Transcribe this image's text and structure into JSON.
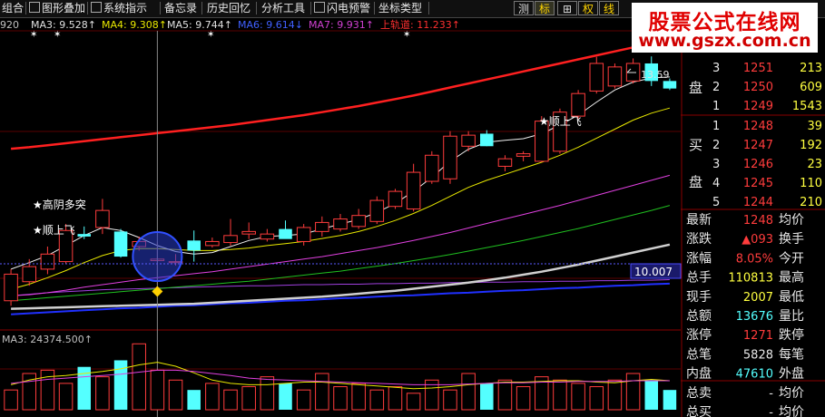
{
  "toolbar": {
    "items": [
      "组合",
      "图形叠加",
      "系统指示",
      "备忘录",
      "历史回忆",
      "分析工具",
      "闪电预警",
      "坐标类型"
    ],
    "right_buttons": [
      "测",
      "标",
      "⊞",
      "权",
      "线"
    ]
  },
  "watermark": {
    "name": "股票公式在线网",
    "url": "www.gszx.com.cn"
  },
  "ma_header": {
    "partial": "920",
    "items": [
      {
        "label": "MA3: 9.528↑",
        "color": "#e0e0e0"
      },
      {
        "label": "MA4: 9.308↑",
        "color": "#e8e800"
      },
      {
        "label": "MA5: 9.744↑",
        "color": "#e0e0e0"
      },
      {
        "label": "MA6: 9.614↓",
        "color": "#4060ff"
      },
      {
        "label": "MA7: 9.931↑",
        "color": "#d040d0"
      },
      {
        "label": "上轨道: 11.233↑",
        "color": "#ff3030"
      }
    ]
  },
  "annotations": {
    "high_yin": "★高阴多突",
    "shunshang_left": "★顺上飞",
    "shunshang_right": "★顺上飞",
    "max_label": "13.59",
    "price_box": "10.007"
  },
  "volume_header": {
    "ma3": "MA3: 24374.500↑"
  },
  "colors": {
    "up": "#ff3c3c",
    "down": "#54ffff",
    "upper_band": "#ff2020",
    "background": "#000000"
  },
  "chart_data": {
    "type": "candlestick",
    "price_range": [
      8.3,
      14.1
    ],
    "candles": [
      {
        "o": 8.72,
        "h": 9.35,
        "l": 8.62,
        "c": 9.25
      },
      {
        "o": 9.1,
        "h": 9.55,
        "l": 9.02,
        "c": 9.4
      },
      {
        "o": 9.35,
        "h": 9.8,
        "l": 9.25,
        "c": 9.65
      },
      {
        "o": 9.5,
        "h": 10.25,
        "l": 9.45,
        "c": 10.12
      },
      {
        "o": 10.05,
        "h": 10.2,
        "l": 9.95,
        "c": 10.0
      },
      {
        "o": 10.18,
        "h": 10.75,
        "l": 10.05,
        "c": 10.52
      },
      {
        "o": 10.1,
        "h": 10.15,
        "l": 9.58,
        "c": 9.6
      },
      {
        "o": 9.8,
        "h": 10.0,
        "l": 9.72,
        "c": 9.9
      },
      {
        "o": 9.52,
        "h": 9.9,
        "l": 9.05,
        "c": 9.55
      },
      {
        "o": 9.48,
        "h": 9.65,
        "l": 9.42,
        "c": 9.5
      },
      {
        "o": 9.92,
        "h": 10.12,
        "l": 9.5,
        "c": 9.72
      },
      {
        "o": 9.82,
        "h": 9.98,
        "l": 9.78,
        "c": 9.9
      },
      {
        "o": 9.88,
        "h": 10.35,
        "l": 9.82,
        "c": 10.02
      },
      {
        "o": 10.05,
        "h": 10.28,
        "l": 9.95,
        "c": 10.1
      },
      {
        "o": 9.95,
        "h": 10.15,
        "l": 9.9,
        "c": 10.05
      },
      {
        "o": 10.15,
        "h": 10.32,
        "l": 10.0,
        "c": 9.95
      },
      {
        "o": 9.9,
        "h": 10.25,
        "l": 9.82,
        "c": 10.18
      },
      {
        "o": 10.1,
        "h": 10.4,
        "l": 10.0,
        "c": 10.28
      },
      {
        "o": 10.15,
        "h": 10.45,
        "l": 10.1,
        "c": 10.35
      },
      {
        "o": 10.2,
        "h": 10.55,
        "l": 10.15,
        "c": 10.42
      },
      {
        "o": 10.3,
        "h": 10.8,
        "l": 10.25,
        "c": 10.72
      },
      {
        "o": 10.6,
        "h": 10.95,
        "l": 10.55,
        "c": 10.9
      },
      {
        "o": 10.55,
        "h": 11.45,
        "l": 10.5,
        "c": 11.28
      },
      {
        "o": 11.1,
        "h": 11.7,
        "l": 11.05,
        "c": 11.62
      },
      {
        "o": 11.15,
        "h": 12.1,
        "l": 11.05,
        "c": 12.0
      },
      {
        "o": 11.8,
        "h": 12.1,
        "l": 11.7,
        "c": 12.02
      },
      {
        "o": 12.05,
        "h": 12.12,
        "l": 11.8,
        "c": 11.8
      },
      {
        "o": 11.4,
        "h": 11.62,
        "l": 11.3,
        "c": 11.55
      },
      {
        "o": 11.6,
        "h": 11.7,
        "l": 11.5,
        "c": 11.65
      },
      {
        "o": 11.5,
        "h": 12.4,
        "l": 11.48,
        "c": 12.3
      },
      {
        "o": 11.7,
        "h": 12.55,
        "l": 11.65,
        "c": 12.48
      },
      {
        "o": 12.4,
        "h": 12.92,
        "l": 12.35,
        "c": 12.85
      },
      {
        "o": 12.9,
        "h": 13.58,
        "l": 12.85,
        "c": 13.45
      },
      {
        "o": 13.0,
        "h": 13.45,
        "l": 12.95,
        "c": 13.38
      },
      {
        "o": 13.1,
        "h": 13.55,
        "l": 13.05,
        "c": 13.45
      },
      {
        "o": 13.45,
        "h": 13.59,
        "l": 13.0,
        "c": 13.1
      },
      {
        "o": 13.1,
        "h": 13.15,
        "l": 12.92,
        "c": 12.95
      }
    ],
    "ma_short": [
      9.35,
      9.48,
      9.62,
      9.82,
      10.02,
      10.18,
      10.12,
      9.98,
      9.82,
      9.7,
      9.65,
      9.68,
      9.8,
      9.92,
      10.0,
      10.02,
      10.05,
      10.15,
      10.25,
      10.34,
      10.48,
      10.66,
      10.9,
      11.18,
      11.5,
      11.74,
      11.88,
      11.92,
      11.95,
      12.05,
      12.22,
      12.42,
      12.68,
      12.92,
      13.08,
      13.16,
      13.18
    ],
    "ma_yellow": [
      8.95,
      9.05,
      9.18,
      9.32,
      9.48,
      9.62,
      9.72,
      9.76,
      9.76,
      9.74,
      9.72,
      9.72,
      9.74,
      9.77,
      9.82,
      9.86,
      9.9,
      9.96,
      10.02,
      10.1,
      10.2,
      10.32,
      10.46,
      10.62,
      10.8,
      10.98,
      11.12,
      11.24,
      11.36,
      11.48,
      11.62,
      11.78,
      11.96,
      12.14,
      12.32,
      12.46,
      12.56
    ],
    "ma_magenta": [
      8.82,
      8.84,
      8.88,
      8.93,
      8.99,
      9.04,
      9.09,
      9.14,
      9.18,
      9.22,
      9.26,
      9.3,
      9.35,
      9.4,
      9.45,
      9.5,
      9.55,
      9.6,
      9.66,
      9.72,
      9.78,
      9.85,
      9.92,
      10.0,
      10.08,
      10.17,
      10.26,
      10.35,
      10.44,
      10.53,
      10.62,
      10.72,
      10.82,
      10.92,
      11.02,
      11.12,
      11.22
    ],
    "ma_green": [
      8.72,
      8.75,
      8.78,
      8.81,
      8.84,
      8.87,
      8.9,
      8.93,
      8.96,
      8.99,
      9.02,
      9.05,
      9.08,
      9.11,
      9.15,
      9.19,
      9.23,
      9.27,
      9.31,
      9.36,
      9.41,
      9.46,
      9.52,
      9.58,
      9.64,
      9.71,
      9.78,
      9.85,
      9.92,
      10.0,
      10.08,
      10.16,
      10.25,
      10.34,
      10.43,
      10.52,
      10.62
    ],
    "ma_white": [
      8.56,
      8.57,
      8.58,
      8.59,
      8.6,
      8.61,
      8.62,
      8.63,
      8.64,
      8.65,
      8.66,
      8.68,
      8.7,
      8.72,
      8.74,
      8.76,
      8.78,
      8.8,
      8.83,
      8.86,
      8.89,
      8.92,
      8.96,
      9.0,
      9.04,
      9.08,
      9.13,
      9.18,
      9.24,
      9.3,
      9.37,
      9.44,
      9.52,
      9.6,
      9.68,
      9.76,
      9.84
    ],
    "ma_purple_flat": [
      8.82,
      8.85,
      8.88,
      8.9,
      8.92,
      8.94,
      8.95,
      8.96,
      8.97,
      8.98,
      8.99,
      9.0,
      9.01,
      9.02,
      9.02,
      9.03,
      9.04,
      9.04,
      9.05,
      9.05,
      9.06,
      9.06,
      9.07,
      9.07,
      9.08,
      9.08,
      9.09,
      9.09,
      9.1,
      9.1,
      9.11,
      9.11,
      9.12,
      9.12,
      9.13,
      9.13,
      9.14
    ],
    "ma_blue": [
      8.45,
      8.47,
      8.49,
      8.51,
      8.53,
      8.55,
      8.57,
      8.58,
      8.6,
      8.62,
      8.63,
      8.65,
      8.67,
      8.68,
      8.7,
      8.72,
      8.73,
      8.75,
      8.77,
      8.78,
      8.8,
      8.82,
      8.83,
      8.85,
      8.87,
      8.88,
      8.9,
      8.92,
      8.93,
      8.95,
      8.97,
      8.98,
      9.0,
      9.02,
      9.03,
      9.05,
      9.06
    ],
    "upper_band": [
      11.75,
      11.78,
      11.82,
      11.86,
      11.9,
      11.94,
      11.98,
      12.02,
      12.06,
      12.1,
      12.14,
      12.18,
      12.22,
      12.27,
      12.32,
      12.37,
      12.42,
      12.48,
      12.54,
      12.6,
      12.67,
      12.74,
      12.81,
      12.89,
      12.97,
      13.05,
      13.13,
      13.21,
      13.29,
      13.37,
      13.45,
      13.53,
      13.61,
      13.69,
      13.77,
      13.85,
      13.93
    ],
    "volume": [
      30,
      55,
      60,
      40,
      65,
      50,
      75,
      100,
      60,
      45,
      30,
      40,
      30,
      35,
      50,
      40,
      30,
      55,
      35,
      40,
      30,
      35,
      25,
      45,
      30,
      55,
      40,
      45,
      35,
      50,
      45,
      40,
      35,
      45,
      55,
      45,
      30
    ],
    "volume_ma_a": [
      38,
      45,
      50,
      52,
      55,
      58,
      62,
      68,
      72,
      66,
      56,
      45,
      40,
      38,
      38,
      40,
      42,
      42,
      40,
      38,
      36,
      34,
      32,
      33,
      35,
      38,
      40,
      42,
      42,
      43,
      44,
      44,
      42,
      41,
      44,
      46,
      44
    ],
    "volume_ma_b": [
      40,
      43,
      46,
      48,
      50,
      52,
      54,
      57,
      60,
      60,
      58,
      55,
      52,
      48,
      46,
      45,
      44,
      43,
      42,
      41,
      40,
      39,
      38,
      38,
      38,
      39,
      40,
      41,
      41,
      42,
      42,
      43,
      43,
      43,
      44,
      44,
      44
    ]
  },
  "side_panel": {
    "sell_label_top": "盘",
    "sell_rows": [
      {
        "lvl": "3",
        "price": "1251",
        "vol": "213"
      },
      {
        "lvl": "2",
        "price": "1250",
        "vol": "609"
      },
      {
        "lvl": "1",
        "price": "1249",
        "vol": "1543"
      }
    ],
    "buy_label": "买",
    "buy_label2": "盘",
    "buy_rows": [
      {
        "lvl": "1",
        "price": "1248",
        "vol": "39"
      },
      {
        "lvl": "2",
        "price": "1247",
        "vol": "192"
      },
      {
        "lvl": "3",
        "price": "1246",
        "vol": "23"
      },
      {
        "lvl": "4",
        "price": "1245",
        "vol": "110"
      },
      {
        "lvl": "5",
        "price": "1244",
        "vol": "210"
      }
    ],
    "stats": [
      {
        "l1": "最新",
        "v1": "1248",
        "l2": "均价",
        "c": "#ff3c3c"
      },
      {
        "l1": "涨跌",
        "v1": "▲093",
        "l2": "换手",
        "c": "#ff3c3c"
      },
      {
        "l1": "涨幅",
        "v1": "8.05%",
        "l2": "今开",
        "c": "#ff3c3c"
      },
      {
        "l1": "总手",
        "v1": "110813",
        "l2": "最高",
        "c": "#ffff40"
      },
      {
        "l1": "现手",
        "v1": "2007",
        "l2": "最低",
        "c": "#ffff40"
      },
      {
        "l1": "总额",
        "v1": "13676",
        "l2": "量比",
        "c": "#54ffff"
      },
      {
        "l1": "涨停",
        "v1": "1271",
        "l2": "跌停",
        "c": "#ff3c3c"
      },
      {
        "l1": "总笔",
        "v1": "5828",
        "l2": "每笔",
        "c": "#e8e8e8"
      },
      {
        "l1": "内盘",
        "v1": "47610",
        "l2": "外盘",
        "c": "#54ffff"
      },
      {
        "l1": "总卖",
        "v1": "-",
        "l2": "均价",
        "c": "#e8e8e8"
      },
      {
        "l1": "总买",
        "v1": "-",
        "l2": "均价",
        "c": "#e8e8e8"
      }
    ]
  }
}
